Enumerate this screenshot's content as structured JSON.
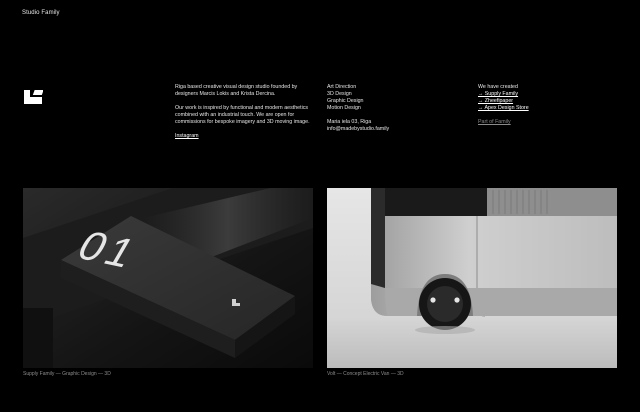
{
  "header": {
    "studio_name": "Studio Family"
  },
  "about": {
    "intro": "Riga based creative visual design studio founded by designers Marcis Lokis and Krista Dercina.",
    "body": "Our work is inspired by functional and modern aesthetics combined with an industrial touch. We are open for commissions for bespoke imagery and 3D moving image.",
    "instagram_label": "Instagram"
  },
  "services": {
    "items": [
      "Art Direction",
      "3D Design",
      "Graphic Design",
      "Motion Design"
    ],
    "address": "Maria iela 03, Riga",
    "email": "info@madebystudio.family"
  },
  "projects": {
    "heading": "We have created",
    "links": [
      "→ Supply Family",
      "→ Zheefipaper",
      "→ Apex Design Store"
    ],
    "part_of": "Part of Family"
  },
  "cards": [
    {
      "number_text": "01",
      "caption": "Supply Family — Graphic Design — 3D"
    },
    {
      "caption": "Volt — Concept Electric Van — 3D"
    }
  ]
}
